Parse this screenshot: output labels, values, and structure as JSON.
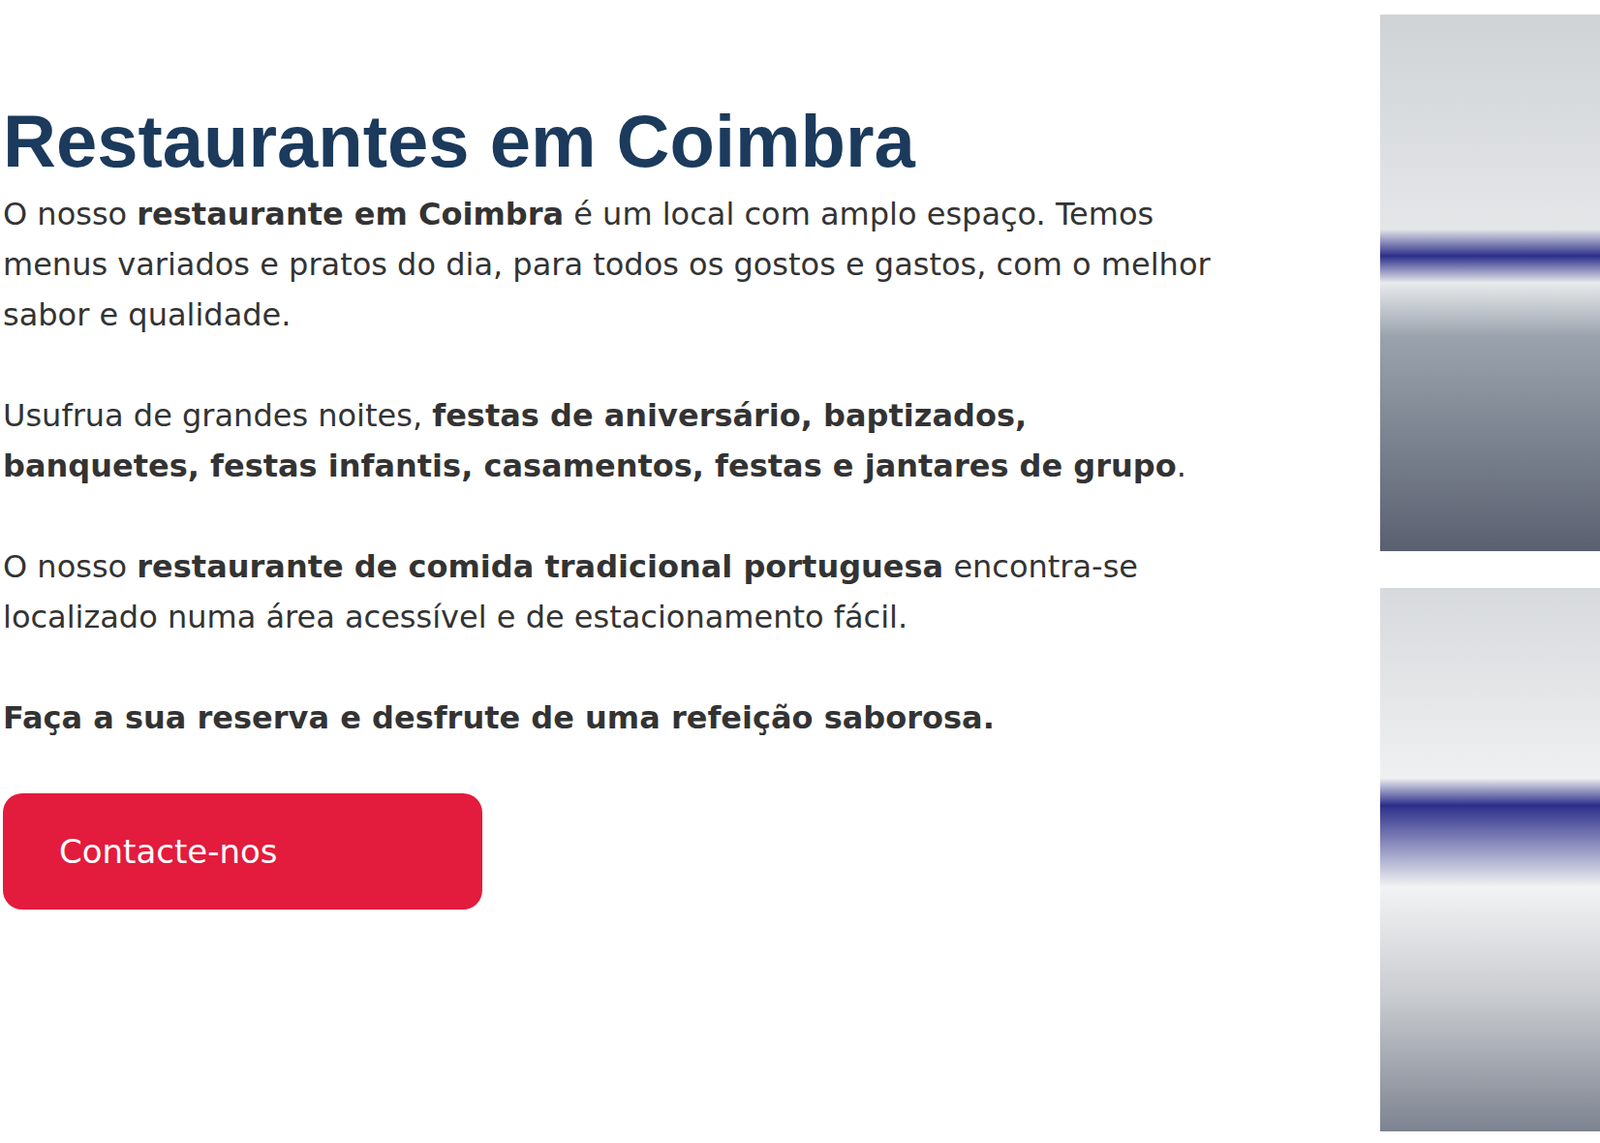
{
  "heading": "Restaurantes em Coimbra",
  "paragraphs": [
    [
      {
        "text": "O nosso ",
        "bold": false
      },
      {
        "text": "restaurante em Coimbra",
        "bold": true
      },
      {
        "text": " é um local com amplo espaço. Temos menus variados e pratos do dia, para todos os gostos e gastos, com o melhor sabor e qualidade.",
        "bold": false
      }
    ],
    [
      {
        "text": "Usufrua de grandes noites, ",
        "bold": false
      },
      {
        "text": "festas de aniversário, baptizados, banquetes, festas infantis, casamentos, festas e jantares de grupo",
        "bold": true
      },
      {
        "text": ".",
        "bold": false
      }
    ],
    [
      {
        "text": "O nosso ",
        "bold": false
      },
      {
        "text": "restaurante de comida tradicional portuguesa",
        "bold": true
      },
      {
        "text": " encontra-se localizado numa área acessível e de estacionamento fácil.",
        "bold": false
      }
    ],
    [
      {
        "text": "Faça a sua reserva e desfrute de uma refeição saborosa.",
        "bold": true
      }
    ]
  ],
  "button": "Contacte-nos"
}
